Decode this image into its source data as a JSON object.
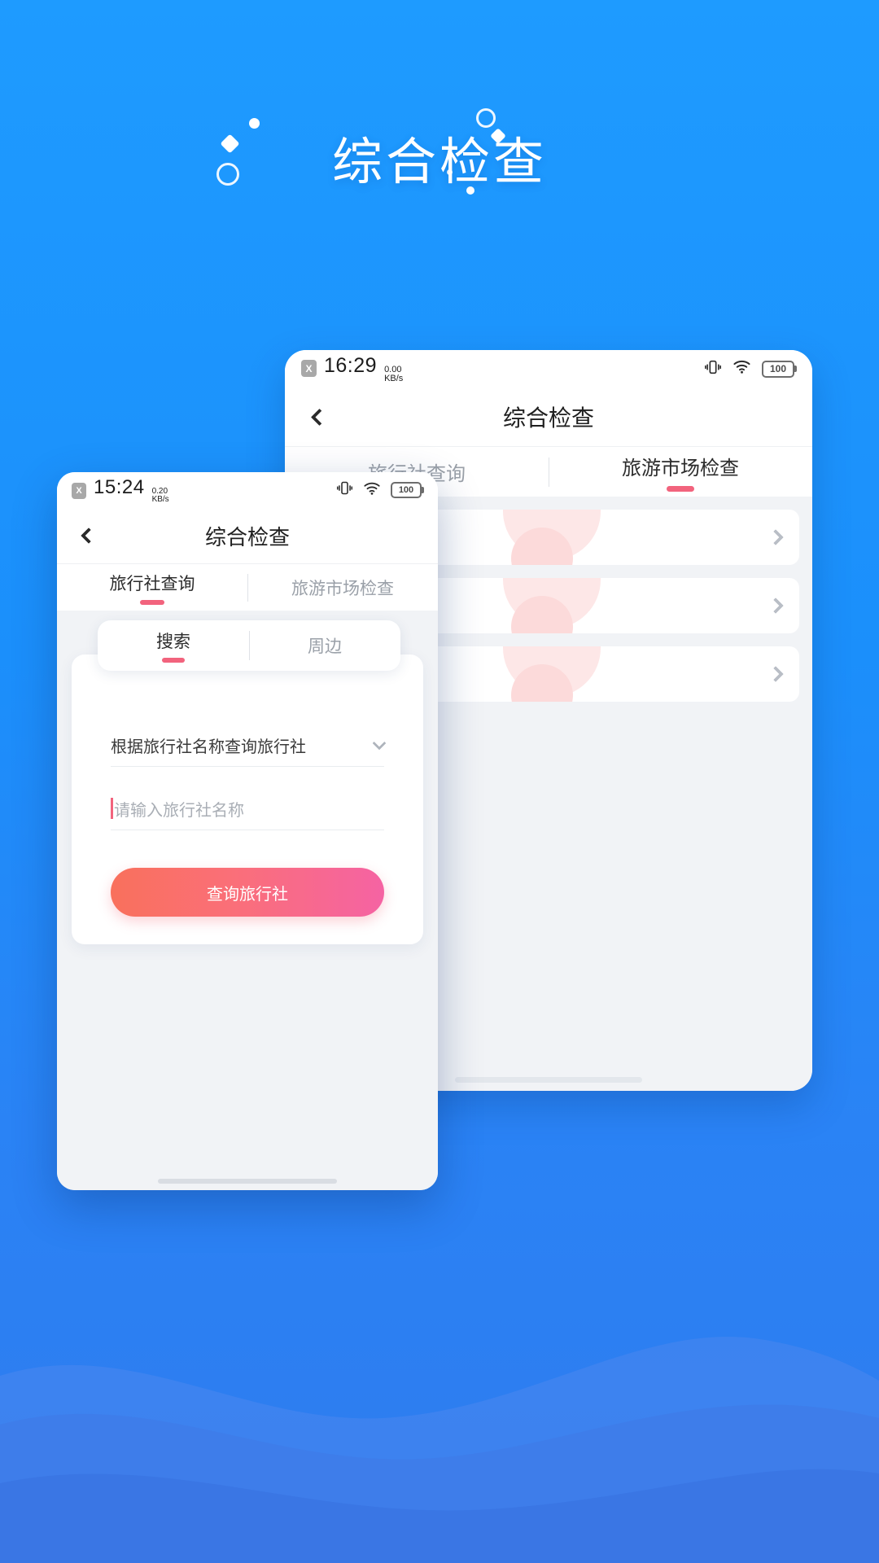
{
  "hero": {
    "title": "综合检查",
    "decorations": [
      "circle-outline-icon",
      "dot-icon",
      "diamond-icon",
      "small-dot-icon"
    ]
  },
  "theme": {
    "bg_top": "#1e9bff",
    "bg_bottom": "#2f7bee",
    "accent_pink": "#f2637d",
    "btn_gradient_from": "#f9705c",
    "btn_gradient_to": "#f563a3",
    "screen_bg": "#f1f3f6"
  },
  "back_phone": {
    "statusbar": {
      "sim_label": "X",
      "time": "16:29",
      "net_value": "0.00",
      "net_unit": "KB/s",
      "vibrate_icon": "vibrate-icon",
      "wifi_icon": "wifi-icon",
      "battery_level": "100"
    },
    "navbar": {
      "back_icon": "chevron-left-icon",
      "title": "综合检查"
    },
    "tabs": [
      {
        "label": "旅行社查询",
        "active": false
      },
      {
        "label": "旅游市场检查",
        "active": true
      }
    ],
    "list_items": [
      {
        "chevron_icon": "chevron-right-icon"
      },
      {
        "chevron_icon": "chevron-right-icon"
      },
      {
        "chevron_icon": "chevron-right-icon"
      }
    ]
  },
  "front_phone": {
    "statusbar": {
      "sim_label": "X",
      "time": "15:24",
      "net_value": "0.20",
      "net_unit": "KB/s",
      "vibrate_icon": "vibrate-icon",
      "wifi_icon": "wifi-icon",
      "battery_level": "100"
    },
    "navbar": {
      "back_icon": "chevron-left-icon",
      "title": "综合检查"
    },
    "tabs": [
      {
        "label": "旅行社查询",
        "active": true
      },
      {
        "label": "旅游市场检查",
        "active": false
      }
    ],
    "subtabs": [
      {
        "label": "搜索",
        "active": true
      },
      {
        "label": "周边",
        "active": false
      }
    ],
    "form": {
      "select_value": "根据旅行社名称查询旅行社",
      "select_icon": "chevron-down-icon",
      "input_placeholder": "请输入旅行社名称",
      "input_value": "",
      "submit_label": "查询旅行社"
    }
  }
}
